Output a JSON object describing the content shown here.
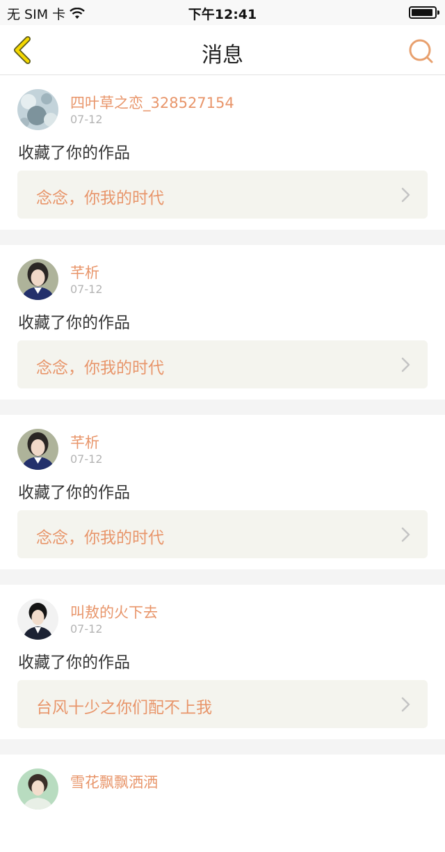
{
  "status": {
    "carrier": "无 SIM 卡",
    "time": "下午12:41"
  },
  "nav": {
    "title": "消息",
    "back_icon": "chevron-left-icon",
    "search_icon": "search-icon"
  },
  "colors": {
    "accent": "#e8956a",
    "back": "#e2c400"
  },
  "messages": [
    {
      "user": "四叶草之恋_328527154",
      "date": "07-12",
      "action": "收藏了你的作品",
      "work": "念念，你我的时代"
    },
    {
      "user": "芊析",
      "date": "07-12",
      "action": "收藏了你的作品",
      "work": "念念，你我的时代"
    },
    {
      "user": "芊析",
      "date": "07-12",
      "action": "收藏了你的作品",
      "work": "念念，你我的时代"
    },
    {
      "user": "叫敖的火下去",
      "date": "07-12",
      "action": "收藏了你的作品",
      "work": "台风十少之你们配不上我"
    },
    {
      "user": "雪花飘飘洒洒"
    }
  ]
}
